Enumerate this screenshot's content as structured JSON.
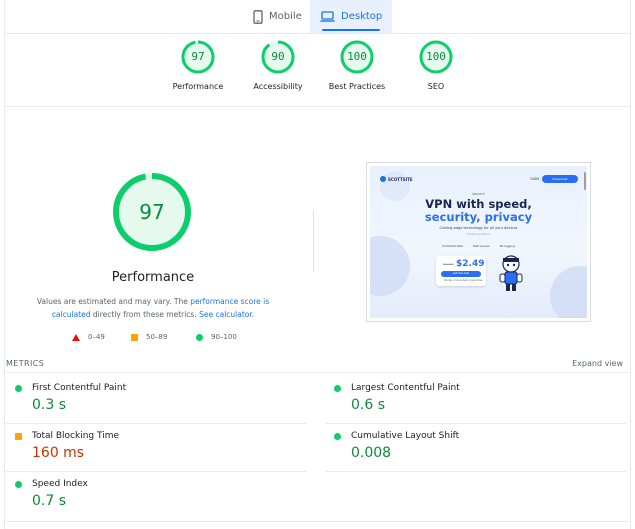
{
  "tabs": [
    {
      "label": "Mobile",
      "icon": "smartphone-icon",
      "active": false
    },
    {
      "label": "Desktop",
      "icon": "laptop-icon",
      "active": true
    }
  ],
  "categories": [
    {
      "score": "97",
      "label": "Performance",
      "fraction": 0.97
    },
    {
      "score": "90",
      "label": "Accessibility",
      "fraction": 0.9
    },
    {
      "score": "100",
      "label": "Best Practices",
      "fraction": 1.0
    },
    {
      "score": "100",
      "label": "SEO",
      "fraction": 1.0
    }
  ],
  "performance": {
    "score": "97",
    "fraction": 0.97,
    "title": "Performance",
    "desc_1": "Values are estimated and may vary. The ",
    "desc_link_1": "performance score is calculated",
    "desc_2": " directly from these metrics. ",
    "desc_link_2": "See calculator",
    "desc_3": "."
  },
  "legend": [
    {
      "range": "0–49",
      "shape": "triangle",
      "color": "#eb0f00"
    },
    {
      "range": "50–89",
      "shape": "square",
      "color": "#ffa400"
    },
    {
      "range": "90–100",
      "shape": "circle",
      "color": "#0cce6b"
    }
  ],
  "preview": {
    "logo": "SCOTTSITE",
    "nav": "SIGN",
    "button": "Download",
    "eyebrow": "PRIVATE",
    "headline_1": "VPN with speed,",
    "headline_2": "security, privacy",
    "subhead": "Cutting-edge technology for all your devices",
    "tagline": "Trusted by millions",
    "features": [
      "Unlimited data",
      "Fast servers",
      "No logging"
    ],
    "old_price": "$12.99",
    "price": "$2.49",
    "cta": "Get this deal",
    "guarantee": "30-day money-back guarantee"
  },
  "metrics": {
    "header": "METRICS",
    "expand_label": "Expand view",
    "items": [
      {
        "name": "First Contentful Paint",
        "value": "0.3 s",
        "status": "good"
      },
      {
        "name": "Largest Contentful Paint",
        "value": "0.6 s",
        "status": "good"
      },
      {
        "name": "Total Blocking Time",
        "value": "160 ms",
        "status": "avg"
      },
      {
        "name": "Cumulative Layout Shift",
        "value": "0.008",
        "status": "good"
      },
      {
        "name": "Speed Index",
        "value": "0.7 s",
        "status": "good"
      }
    ]
  },
  "colors": {
    "pass": "#0cce6b",
    "pass_text": "#0d8a3c",
    "average": "#ffa400",
    "average_text": "#c33300",
    "fail": "#eb0f00",
    "accent": "#1a73e8"
  }
}
